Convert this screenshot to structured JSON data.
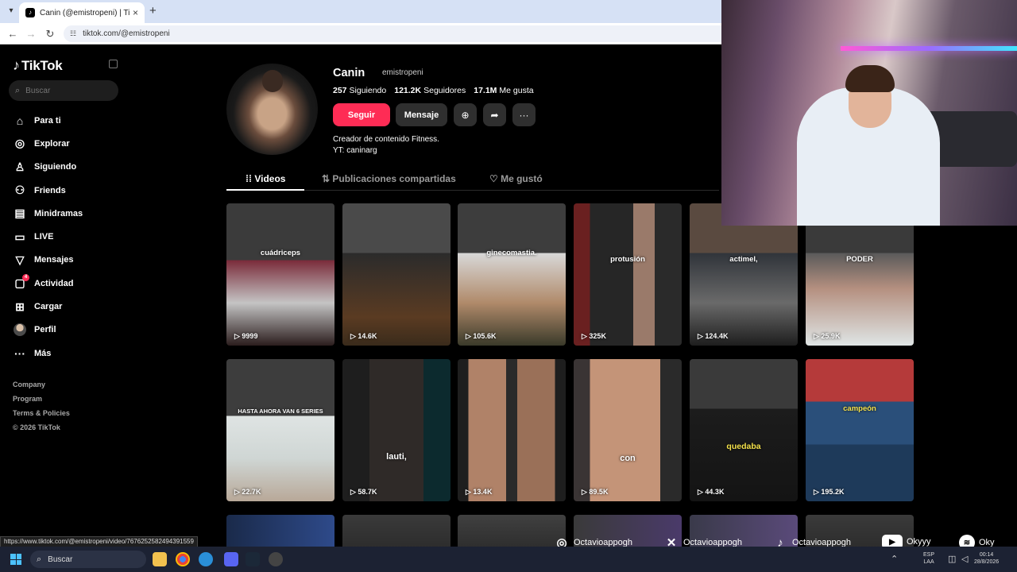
{
  "browser": {
    "tab_title": "Canin (@emistropeni) | TikTok",
    "url": "tiktok.com/@emistropeni",
    "status_url": "https://www.tiktok.com/@emistropeni/video/7676252582494391559"
  },
  "sidebar": {
    "logo": "TikTok",
    "search_placeholder": "Buscar",
    "items": [
      {
        "label": "Para ti",
        "icon": "home-icon"
      },
      {
        "label": "Explorar",
        "icon": "compass-icon"
      },
      {
        "label": "Siguiendo",
        "icon": "following-icon"
      },
      {
        "label": "Friends",
        "icon": "friends-icon"
      },
      {
        "label": "Minidramas",
        "icon": "minidramas-icon"
      },
      {
        "label": "LIVE",
        "icon": "live-icon"
      },
      {
        "label": "Mensajes",
        "icon": "messages-icon"
      },
      {
        "label": "Actividad",
        "icon": "activity-icon",
        "badge": "4"
      },
      {
        "label": "Cargar",
        "icon": "upload-icon"
      },
      {
        "label": "Perfil",
        "icon": "profile-avatar"
      },
      {
        "label": "Más",
        "icon": "more-icon"
      }
    ],
    "footer": [
      "Company",
      "Program",
      "Terms & Policies",
      "© 2026 TikTok"
    ]
  },
  "profile": {
    "name": "Canin",
    "handle": "emistropeni",
    "following_count": "257",
    "following_label": "Siguiendo",
    "followers_count": "121.2K",
    "followers_label": "Seguidores",
    "likes_count": "17.1M",
    "likes_label": "Me gusta",
    "follow_label": "Seguir",
    "message_label": "Mensaje",
    "bio_line1": "Creador de contenido Fitness.",
    "bio_line2": "YT: caninarg"
  },
  "tabs": [
    {
      "label": "Videos",
      "active": true
    },
    {
      "label": "Publicaciones compartidas",
      "active": false
    },
    {
      "label": "Me gustó",
      "active": false
    }
  ],
  "videos": [
    {
      "caption": "cuádriceps",
      "views": "9999"
    },
    {
      "caption": "",
      "views": "14.6K"
    },
    {
      "caption": "ginecomastia.",
      "views": "105.6K"
    },
    {
      "caption": "protusión",
      "views": "325K"
    },
    {
      "caption": "actimel,",
      "views": "124.4K"
    },
    {
      "caption": "PODER",
      "views": "25.9K"
    },
    {
      "caption": "HASTA AHORA VAN 6 SERIES",
      "views": "22.7K"
    },
    {
      "caption": "lauti,",
      "views": "58.7K"
    },
    {
      "caption": "",
      "views": "13.4K"
    },
    {
      "caption": "con",
      "views": "89.5K"
    },
    {
      "caption": "quedaba",
      "views": "44.3K"
    },
    {
      "caption": "campeón",
      "views": "195.2K"
    }
  ],
  "social": [
    {
      "icon": "instagram-icon",
      "handle": "Octavioappogh"
    },
    {
      "icon": "x-icon",
      "handle": "Octavioappogh"
    },
    {
      "icon": "tiktok-icon",
      "handle": "Octavioappogh"
    },
    {
      "icon": "youtube-icon",
      "handle": "Okyyy"
    },
    {
      "icon": "spotify-icon",
      "handle": "Oky"
    }
  ],
  "taskbar": {
    "search_label": "Buscar",
    "lang_line1": "ESP",
    "lang_line2": "LAA",
    "time": "00:14",
    "date": "28/8/2026"
  }
}
